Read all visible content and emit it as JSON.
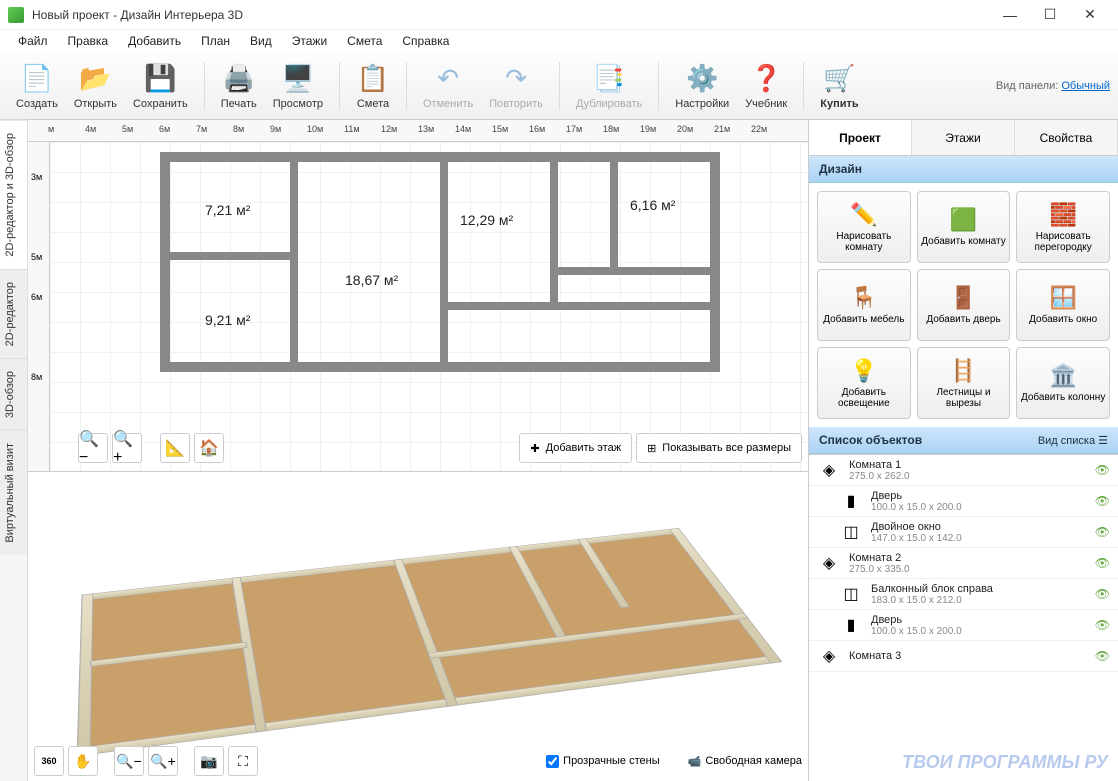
{
  "window": {
    "title": "Новый проект - Дизайн Интерьера 3D"
  },
  "menu": [
    "Файл",
    "Правка",
    "Добавить",
    "План",
    "Вид",
    "Этажи",
    "Смета",
    "Справка"
  ],
  "toolbar": {
    "create": "Создать",
    "open": "Открыть",
    "save": "Сохранить",
    "print": "Печать",
    "preview": "Просмотр",
    "estimate": "Смета",
    "undo": "Отменить",
    "redo": "Повторить",
    "duplicate": "Дублировать",
    "settings": "Настройки",
    "tutorial": "Учебник",
    "buy": "Купить",
    "panel_mode_label": "Вид панели:",
    "panel_mode_value": "Обычный"
  },
  "vtabs": {
    "t1": "2D-редактор и 3D-обзор",
    "t2": "2D-редактор",
    "t3": "3D-обзор",
    "t4": "Виртуальный визит"
  },
  "ruler_h": [
    "м",
    "4м",
    "5м",
    "6м",
    "7м",
    "8м",
    "9м",
    "10м",
    "11м",
    "12м",
    "13м",
    "14м",
    "15м",
    "16м",
    "17м",
    "18м",
    "19м",
    "20м",
    "21м",
    "22м"
  ],
  "ruler_v": [
    "3м",
    "5м",
    "6м",
    "8м"
  ],
  "rooms": {
    "r1": "7,21 м²",
    "r2": "18,67 м²",
    "r3": "12,29 м²",
    "r4": "6,16 м²",
    "r5": "9,21 м²"
  },
  "plan_tb": {
    "add_floor": "Добавить этаж",
    "show_dims": "Показывать все размеры"
  },
  "view3d_tb": {
    "transparent": "Прозрачные стены",
    "free_camera": "Свободная камера"
  },
  "right_tabs": {
    "project": "Проект",
    "floors": "Этажи",
    "props": "Свойства"
  },
  "sections": {
    "design": "Дизайн",
    "objects": "Список объектов",
    "list_mode": "Вид списка"
  },
  "design": {
    "draw_room": "Нарисовать комнату",
    "add_room": "Добавить комнату",
    "draw_wall": "Нарисовать перегородку",
    "add_furniture": "Добавить мебель",
    "add_door": "Добавить дверь",
    "add_window": "Добавить окно",
    "add_light": "Добавить освещение",
    "stairs": "Лестницы и вырезы",
    "add_column": "Добавить колонну"
  },
  "objects": [
    {
      "name": "Комната 1",
      "size": "275.0 x 262.0",
      "icon": "◈",
      "sub": false
    },
    {
      "name": "Дверь",
      "size": "100.0 x 15.0 x 200.0",
      "icon": "▮",
      "sub": true
    },
    {
      "name": "Двойное окно",
      "size": "147.0 x 15.0 x 142.0",
      "icon": "◫",
      "sub": true
    },
    {
      "name": "Комната 2",
      "size": "275.0 x 335.0",
      "icon": "◈",
      "sub": false
    },
    {
      "name": "Балконный блок справа",
      "size": "183.0 x 15.0 x 212.0",
      "icon": "◫",
      "sub": true
    },
    {
      "name": "Дверь",
      "size": "100.0 x 15.0 x 200.0",
      "icon": "▮",
      "sub": true
    },
    {
      "name": "Комната 3",
      "size": "",
      "icon": "◈",
      "sub": false
    }
  ],
  "watermark": "ТВОИ ПРОГРАММЫ РУ"
}
